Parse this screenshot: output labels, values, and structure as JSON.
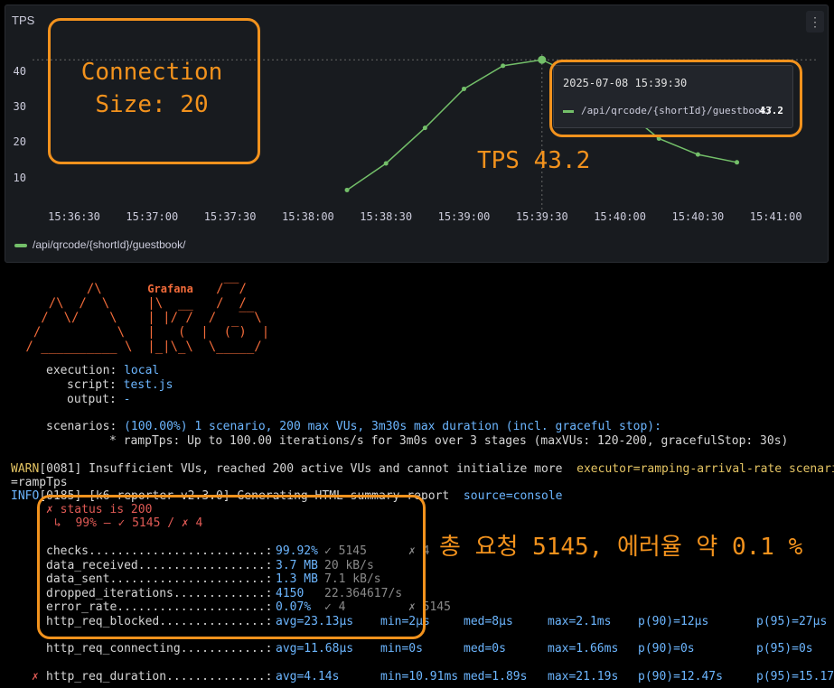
{
  "panel": {
    "title": "TPS",
    "menu_icon": "kebab-menu-icon",
    "legend_label": "/api/qrcode/{shortId}/guestbook/"
  },
  "chart_data": {
    "type": "line",
    "title": "TPS",
    "x": [
      "15:38:15",
      "15:38:30",
      "15:38:45",
      "15:39:00",
      "15:39:15",
      "15:39:30",
      "15:39:45",
      "15:40:00",
      "15:40:15",
      "15:40:30",
      "15:40:45",
      "15:41:00"
    ],
    "xticks": [
      "15:36:30",
      "15:37:00",
      "15:37:30",
      "15:38:00",
      "15:38:30",
      "15:39:00",
      "15:39:30",
      "15:40:00",
      "15:40:30",
      "15:41:00"
    ],
    "yticks": [
      10,
      20,
      30,
      40
    ],
    "ylim": [
      0,
      45
    ],
    "series": [
      {
        "name": "/api/qrcode/{shortId}/guestbook/",
        "values": [
          6.5,
          14,
          24,
          35,
          41.5,
          43.2,
          38,
          30,
          21,
          16.5,
          14.3,
          null
        ],
        "color": "#73bf69"
      }
    ],
    "threshold_line": 43.2,
    "grid": false,
    "legend": "bottom-left"
  },
  "tooltip": {
    "time": "2025-07-08 15:39:30",
    "series": "/api/qrcode/{shortId}/guestbook/",
    "value": "43.2"
  },
  "annotations": {
    "connection": "Connection\nSize: 20",
    "tps": "TPS 43.2",
    "summary": "총 요청 5145, 에러율 약 0.1 %"
  },
  "k6_logo": {
    "label": "Grafana",
    "ascii": [
      "         /\\      Grafana   /‾‾/  ",
      "    /\\  /  \\     |\\  __   /  /   ",
      "   /  \\/    \\    | |/ /  /   ‾‾\\ ",
      "  /          \\   |   (  |  (‾)  |",
      " / __________ \\  |_|\\_\\  \\_____/ "
    ]
  },
  "terminal": {
    "execution_key": "execution:",
    "execution_val": "local",
    "script_key": "script:",
    "script_val": "test.js",
    "output_key": "output:",
    "output_val": "-",
    "scenarios_key": "scenarios:",
    "scenarios_val": "(100.00%) 1 scenario, 200 max VUs, 3m30s max duration (incl. graceful stop):",
    "scenario_line": "* rampTps: Up to 100.00 iterations/s for 3m0s over 3 stages (maxVUs: 120-200, gracefulStop: 30s)",
    "warn_tag": "WARN",
    "warn_msg": "[0081] Insufficient VUs, reached 200 active VUs and cannot initialize more  ",
    "warn_kv": "executor=ramping-arrival-rate scenario",
    "warn_cont": "=rampTps",
    "info_tag": "INFO",
    "info_msg": "[0185] [k6-reporter v2.3.0] Generating HTML summary report  ",
    "info_kv": "source=console",
    "status_line": "✗ status is 200",
    "status_sub": "↳  99% — ✓ 5145 / ✗ 4",
    "metrics": [
      {
        "name": "checks.........................:",
        "val": "99.92%",
        "extra": "✓ 5145",
        "extra2": "✗ 4"
      },
      {
        "name": "data_received..................:",
        "val": "3.7 MB",
        "extra": "20 kB/s",
        "extra2": ""
      },
      {
        "name": "data_sent......................:",
        "val": "1.3 MB",
        "extra": "7.1 kB/s",
        "extra2": ""
      },
      {
        "name": "dropped_iterations.............:",
        "val": "4150",
        "extra": "22.364617/s",
        "extra2": ""
      },
      {
        "name": "error_rate.....................:",
        "val": "0.07%",
        "extra": "✓ 4",
        "extra2": "✗ 5145"
      }
    ],
    "timing": [
      {
        "mark": "",
        "name": "http_req_blocked...............:",
        "avg": "avg=23.13µs",
        "min": "min=2µs",
        "med": "med=8µs",
        "max": "max=2.1ms",
        "p90": "p(90)=12µs",
        "p95": "p(95)=27µs"
      },
      {
        "mark": "",
        "name": "http_req_connecting............:",
        "avg": "avg=11.68µs",
        "min": "min=0s",
        "med": "med=0s",
        "max": "max=1.66ms",
        "p90": "p(90)=0s",
        "p95": "p(95)=0s"
      },
      {
        "mark": "✗",
        "name": "http_req_duration..............:",
        "avg": "avg=4.14s",
        "min": "min=10.91ms",
        "med": "med=1.89s",
        "max": "max=21.19s",
        "p90": "p(90)=12.47s",
        "p95": "p(95)=15.17"
      }
    ]
  }
}
